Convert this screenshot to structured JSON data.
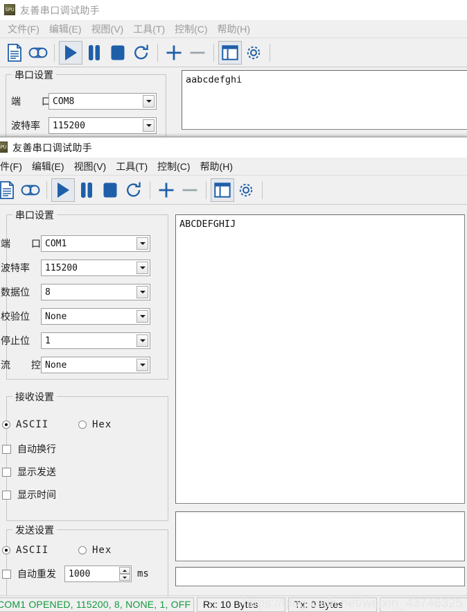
{
  "back_window": {
    "title": "友善串口调试助手",
    "icon_label": "SPU",
    "menu": [
      {
        "label": "文件(F)"
      },
      {
        "label": "编辑(E)"
      },
      {
        "label": "视图(V)"
      },
      {
        "label": "工具(T)"
      },
      {
        "label": "控制(C)"
      },
      {
        "label": "帮助(H)"
      }
    ],
    "toolbar_icons": [
      "document-icon",
      "tape-icon",
      "play-icon",
      "pause-icon",
      "stop-icon",
      "refresh-icon",
      "plus-icon",
      "minus-icon",
      "panel-icon",
      "gear-icon"
    ],
    "serial_group_title": "串口设置",
    "fields": [
      {
        "label": "端    口",
        "value": "COM8"
      },
      {
        "label": "波特率",
        "value": "115200"
      }
    ],
    "receive_text": "aabcdefghi"
  },
  "front_window": {
    "title": "友善串口调试助手",
    "icon_label": "SPU",
    "menu": [
      {
        "label": "件(F)"
      },
      {
        "label": "编辑(E)"
      },
      {
        "label": "视图(V)"
      },
      {
        "label": "工具(T)"
      },
      {
        "label": "控制(C)"
      },
      {
        "label": "帮助(H)"
      }
    ],
    "toolbar_icons": [
      "document-icon",
      "tape-icon",
      "play-icon",
      "pause-icon",
      "stop-icon",
      "refresh-icon",
      "plus-icon",
      "minus-icon",
      "panel-icon",
      "gear-icon"
    ],
    "serial_settings": {
      "title": "串口设置",
      "fields": [
        {
          "name": "port",
          "label": "端    口",
          "value": "COM1"
        },
        {
          "name": "baudrate",
          "label": "波特率",
          "value": "115200"
        },
        {
          "name": "databits",
          "label": "数据位",
          "value": "8"
        },
        {
          "name": "parity",
          "label": "校验位",
          "value": "None"
        },
        {
          "name": "stopbits",
          "label": "停止位",
          "value": "1"
        },
        {
          "name": "flowctrl",
          "label": "流    控",
          "value": "None"
        }
      ]
    },
    "receive_settings": {
      "title": "接收设置",
      "ascii_label": "ASCII",
      "hex_label": "Hex",
      "mode_selected": "ASCII",
      "checkboxes": [
        {
          "label": "自动换行",
          "checked": false
        },
        {
          "label": "显示发送",
          "checked": false
        },
        {
          "label": "显示时间",
          "checked": false
        }
      ]
    },
    "send_settings": {
      "title": "发送设置",
      "ascii_label": "ASCII",
      "hex_label": "Hex",
      "mode_selected": "ASCII",
      "auto_resend_label": "自动重发",
      "auto_resend_checked": false,
      "interval_value": "1000",
      "interval_unit": "ms"
    },
    "receive_text": "ABCDEFGHIJ",
    "send_text": "",
    "command_text": "",
    "statusbar": {
      "connection": "COM1 OPENED, 115200, 8, NONE, 1, OFF",
      "rx": "Rx: 10 Bytes",
      "tx": "Tx: 0 Bytes",
      "extra": "",
      "connection_color": "#119a3e"
    }
  },
  "watermark": "https://blog.csdn.net/weixin_43746325"
}
